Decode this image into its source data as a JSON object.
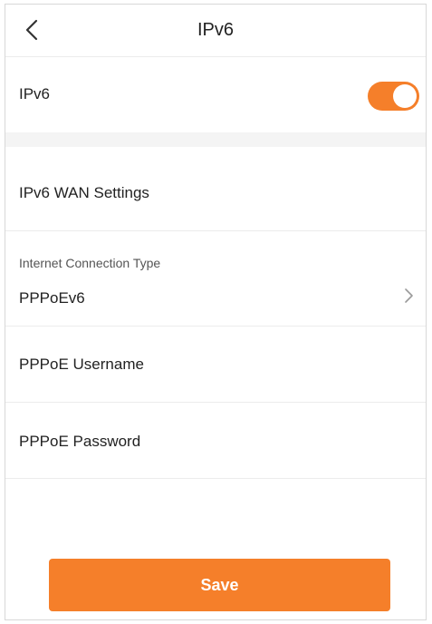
{
  "header": {
    "title": "IPv6",
    "back_icon": "chevron-left-icon"
  },
  "ipv6_toggle": {
    "label": "IPv6",
    "enabled": true,
    "accent_color": "#f57f2a"
  },
  "wan_section": {
    "title": "IPv6 WAN Settings"
  },
  "connection_type": {
    "caption": "Internet Connection Type",
    "value": "PPPoEv6",
    "chevron_icon": "chevron-right-icon"
  },
  "pppoe_username": {
    "label": "PPPoE Username"
  },
  "pppoe_password": {
    "label": "PPPoE Password"
  },
  "actions": {
    "save_label": "Save"
  }
}
